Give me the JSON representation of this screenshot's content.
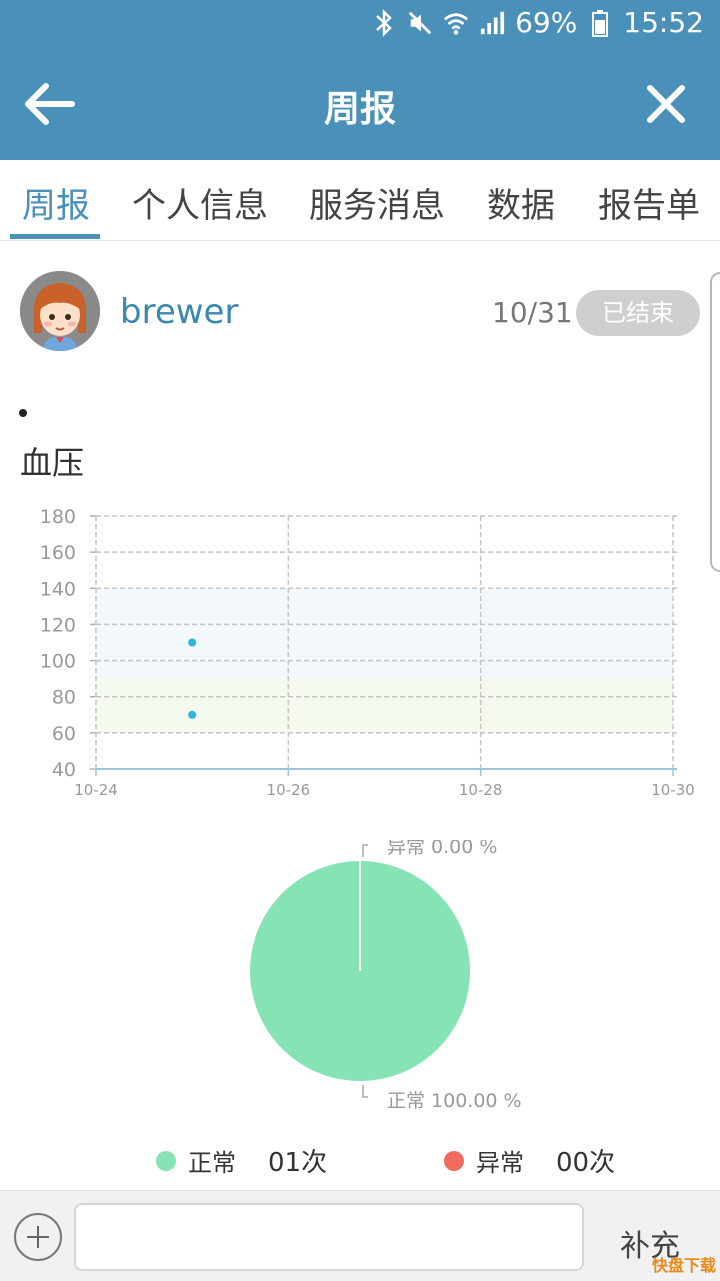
{
  "status_bar": {
    "battery": "69%",
    "time": "15:52"
  },
  "header": {
    "title": "周报"
  },
  "tabs": [
    {
      "label": "周报",
      "active": true
    },
    {
      "label": "个人信息",
      "active": false
    },
    {
      "label": "服务消息",
      "active": false
    },
    {
      "label": "数据",
      "active": false
    },
    {
      "label": "报告单",
      "active": false
    }
  ],
  "report": {
    "username": "brewer",
    "date": "10/31",
    "status": "已结束"
  },
  "section": {
    "title": "血压"
  },
  "chart_data": [
    {
      "type": "scatter",
      "title": "",
      "xlabel": "",
      "ylabel": "",
      "x_ticks": [
        "10-24",
        "10-26",
        "10-28",
        "10-30"
      ],
      "y_ticks": [
        40,
        60,
        80,
        100,
        120,
        140,
        160,
        180
      ],
      "ylim": [
        40,
        180
      ],
      "grid": true,
      "normal_bands": [
        {
          "from": 90,
          "to": 140,
          "color": "#f2f8fc"
        },
        {
          "from": 60,
          "to": 90,
          "color": "#f4faf0"
        }
      ],
      "series": [
        {
          "points": [
            {
              "x": "10-25",
              "y": 110
            },
            {
              "x": "10-25",
              "y": 70
            }
          ],
          "color": "#29b6d8"
        }
      ]
    },
    {
      "type": "pie",
      "slices": [
        {
          "label": "异常 0.00 %",
          "value": 0,
          "color": "#f07070"
        },
        {
          "label": "正常 100.00 %",
          "value": 100,
          "color": "#86e3b3"
        }
      ]
    }
  ],
  "legend": [
    {
      "label": "正常",
      "count": "01次",
      "color": "#86e3b3"
    },
    {
      "label": "异常",
      "count": "00次",
      "color": "#f06a5e"
    }
  ],
  "input": {
    "supplement_label": "补充"
  },
  "watermark": "快盘下载"
}
